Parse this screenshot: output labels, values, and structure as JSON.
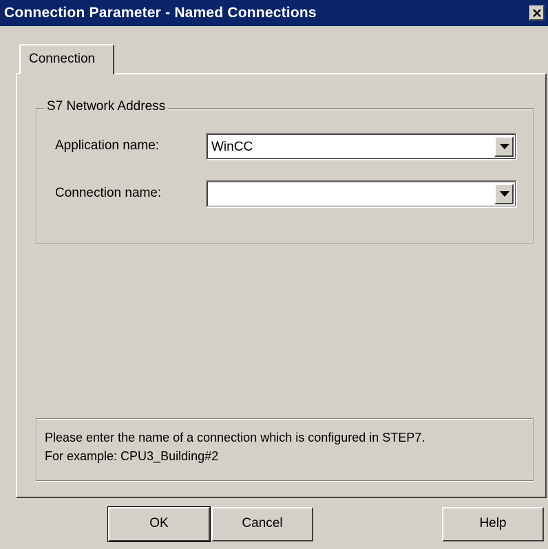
{
  "window": {
    "title": "Connection Parameter - Named Connections",
    "close_icon": "close-icon"
  },
  "tabs": [
    {
      "label": "Connection",
      "selected": true
    }
  ],
  "address_group": {
    "legend": "S7 Network Address",
    "application": {
      "label": "Application name:",
      "value": "WinCC",
      "icon": "chevron-down-icon"
    },
    "connection": {
      "label": "Connection name:",
      "value": "",
      "icon": "chevron-down-icon"
    }
  },
  "hint": {
    "line1": "Please enter the name of a connection which is configured in STEP7.",
    "line2": "For example: CPU3_Building#2"
  },
  "buttons": {
    "ok": "OK",
    "cancel": "Cancel",
    "help": "Help"
  },
  "colors": {
    "titlebar": "#0a246a",
    "face": "#d4d0c8"
  }
}
